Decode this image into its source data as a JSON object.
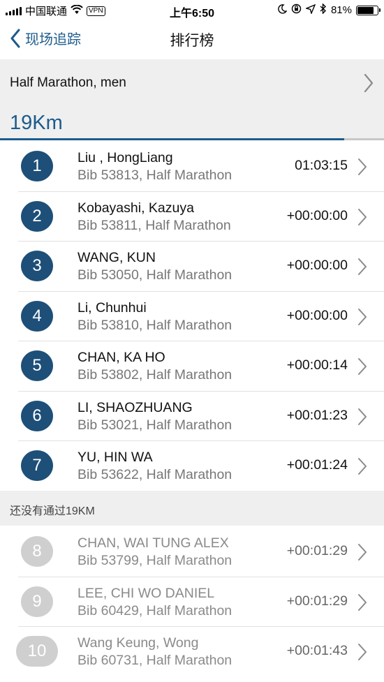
{
  "status_bar": {
    "carrier": "中国联通",
    "vpn": "VPN",
    "time": "上午6:50",
    "battery": "81%",
    "battery_level": 0.81
  },
  "nav": {
    "back_label": "现场追踪",
    "title": "排行榜"
  },
  "race": {
    "label": "Half Marathon, men"
  },
  "split": {
    "label": "19Km",
    "progress": 0.897
  },
  "passed": [
    {
      "rank": "1",
      "name": "Liu , HongLiang",
      "bib": "Bib 53813, Half Marathon",
      "time": "01:03:15"
    },
    {
      "rank": "2",
      "name": "Kobayashi, Kazuya",
      "bib": "Bib 53811, Half Marathon",
      "time": "+00:00:00"
    },
    {
      "rank": "3",
      "name": "WANG, KUN",
      "bib": "Bib 53050, Half Marathon",
      "time": "+00:00:00"
    },
    {
      "rank": "4",
      "name": "Li, Chunhui",
      "bib": "Bib 53810, Half Marathon",
      "time": "+00:00:00"
    },
    {
      "rank": "5",
      "name": "CHAN, KA HO",
      "bib": "Bib 53802, Half Marathon",
      "time": "+00:00:14"
    },
    {
      "rank": "6",
      "name": "LI, SHAOZHUANG",
      "bib": "Bib 53021, Half Marathon",
      "time": "+00:01:23"
    },
    {
      "rank": "7",
      "name": "YU, HIN WA",
      "bib": "Bib 53622, Half Marathon",
      "time": "+00:01:24"
    }
  ],
  "pending_header": "还没有通过19KM",
  "pending": [
    {
      "rank": "8",
      "name": "CHAN, WAI TUNG ALEX",
      "bib": "Bib 53799, Half Marathon",
      "time": "+00:01:29"
    },
    {
      "rank": "9",
      "name": "LEE, CHI WO DANIEL",
      "bib": "Bib 60429, Half Marathon",
      "time": "+00:01:29"
    },
    {
      "rank": "10",
      "name": "Wang Keung, Wong",
      "bib": "Bib 60731, Half Marathon",
      "time": "+00:01:43"
    }
  ],
  "colors": {
    "accent": "#1d5b8c",
    "badge": "#1d4f78",
    "badge_pending": "#cfcfcf"
  }
}
